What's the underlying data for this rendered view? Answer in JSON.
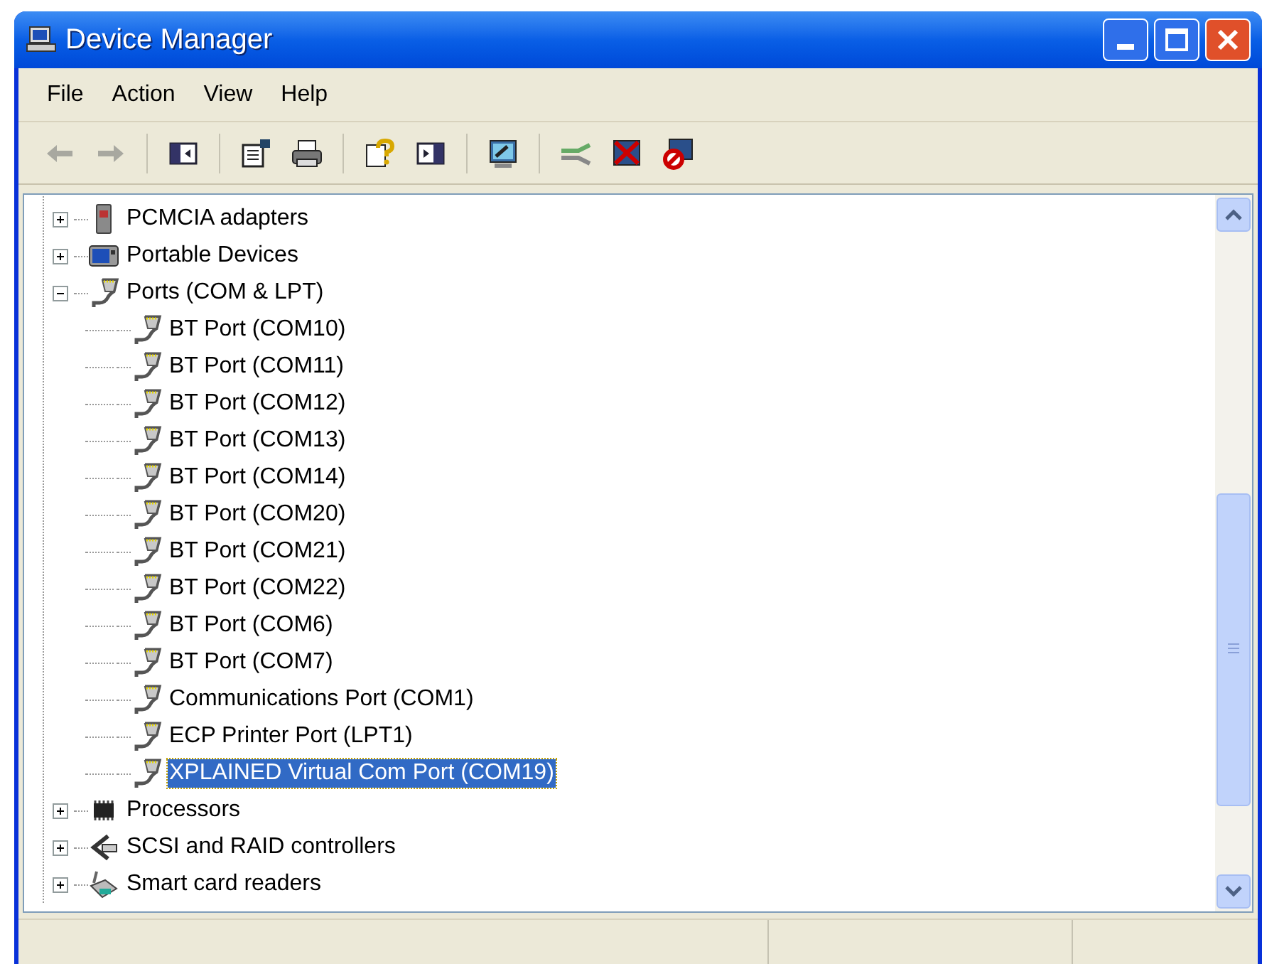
{
  "window": {
    "title": "Device Manager"
  },
  "menu": [
    "File",
    "Action",
    "View",
    "Help"
  ],
  "toolbar": [
    {
      "kind": "back",
      "disabled": true
    },
    {
      "kind": "forward",
      "disabled": true
    },
    {
      "kind": "sep"
    },
    {
      "kind": "console-tree"
    },
    {
      "kind": "sep"
    },
    {
      "kind": "properties"
    },
    {
      "kind": "print"
    },
    {
      "kind": "sep"
    },
    {
      "kind": "help"
    },
    {
      "kind": "action-pane"
    },
    {
      "kind": "sep"
    },
    {
      "kind": "scan"
    },
    {
      "kind": "sep"
    },
    {
      "kind": "update-driver"
    },
    {
      "kind": "uninstall"
    },
    {
      "kind": "disable"
    }
  ],
  "tree": [
    {
      "label": "PCMCIA adapters",
      "kind": "card",
      "expanded": false,
      "selected": false
    },
    {
      "label": "Portable Devices",
      "kind": "portable",
      "expanded": false,
      "selected": false
    },
    {
      "label": "Ports (COM & LPT)",
      "kind": "port",
      "expanded": true,
      "selected": false,
      "children": [
        {
          "label": "BT Port (COM10)",
          "kind": "port",
          "selected": false
        },
        {
          "label": "BT Port (COM11)",
          "kind": "port",
          "selected": false
        },
        {
          "label": "BT Port (COM12)",
          "kind": "port",
          "selected": false
        },
        {
          "label": "BT Port (COM13)",
          "kind": "port",
          "selected": false
        },
        {
          "label": "BT Port (COM14)",
          "kind": "port",
          "selected": false
        },
        {
          "label": "BT Port (COM20)",
          "kind": "port",
          "selected": false
        },
        {
          "label": "BT Port (COM21)",
          "kind": "port",
          "selected": false
        },
        {
          "label": "BT Port (COM22)",
          "kind": "port",
          "selected": false
        },
        {
          "label": "BT Port (COM6)",
          "kind": "port",
          "selected": false
        },
        {
          "label": "BT Port (COM7)",
          "kind": "port",
          "selected": false
        },
        {
          "label": "Communications Port (COM1)",
          "kind": "port",
          "selected": false
        },
        {
          "label": "ECP Printer Port (LPT1)",
          "kind": "port",
          "selected": false
        },
        {
          "label": "XPLAINED Virtual Com Port (COM19)",
          "kind": "port",
          "selected": true
        }
      ]
    },
    {
      "label": "Processors",
      "kind": "chip",
      "expanded": false,
      "selected": false
    },
    {
      "label": "SCSI and RAID controllers",
      "kind": "scsi",
      "expanded": false,
      "selected": false
    },
    {
      "label": "Smart card readers",
      "kind": "reader",
      "expanded": false,
      "selected": false
    }
  ]
}
